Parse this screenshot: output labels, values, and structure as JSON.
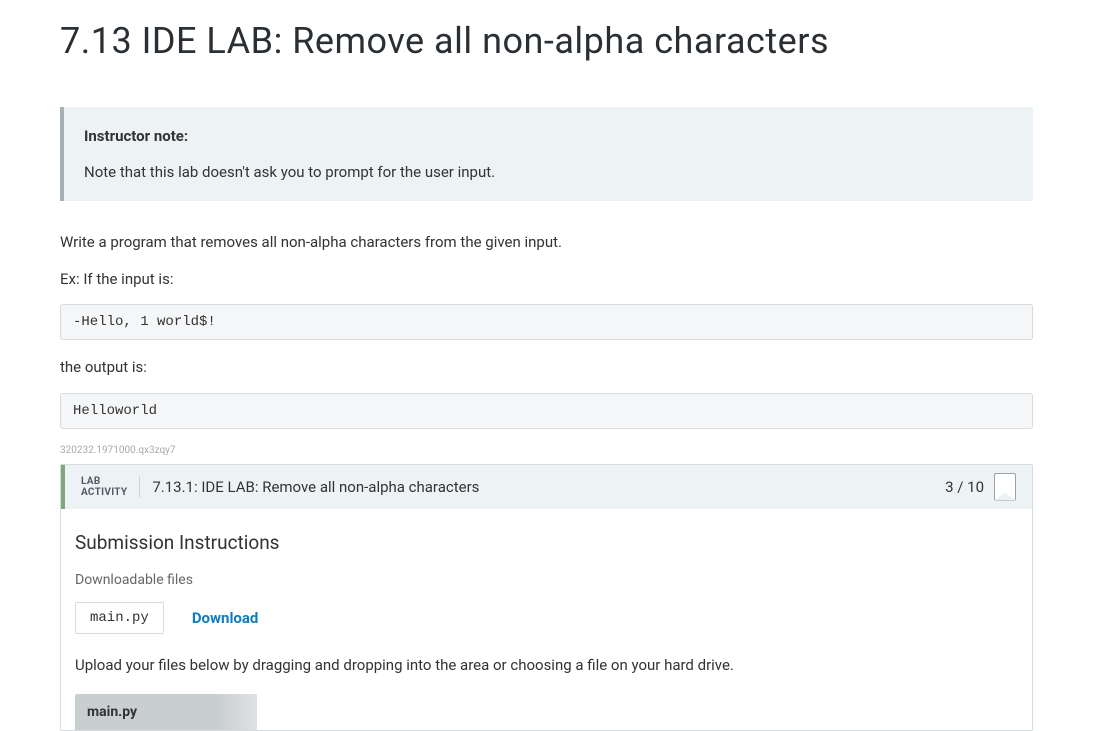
{
  "title": "7.13 IDE LAB: Remove all non-alpha characters",
  "note": {
    "heading": "Instructor note:",
    "body": "Note that this lab doesn't ask you to prompt for the user input."
  },
  "instructions": {
    "line1": "Write a program that removes all non-alpha characters from the given input.",
    "line2": "Ex: If the input is:",
    "example_input": "-Hello, 1 world$!",
    "line3": "the output is:",
    "example_output": "Helloworld"
  },
  "id_string": "320232.1971000.qx3zqy7",
  "lab": {
    "label_line1": "LAB",
    "label_line2": "ACTIVITY",
    "title": "7.13.1: IDE LAB: Remove all non-alpha characters",
    "score": "3 / 10"
  },
  "submission": {
    "heading": "Submission Instructions",
    "downloadable_label": "Downloadable files",
    "filename": "main.py",
    "download_label": "Download",
    "upload_hint": "Upload your files below by dragging and dropping into the area or choosing a file on your hard drive.",
    "upload_filename": "main.py"
  }
}
